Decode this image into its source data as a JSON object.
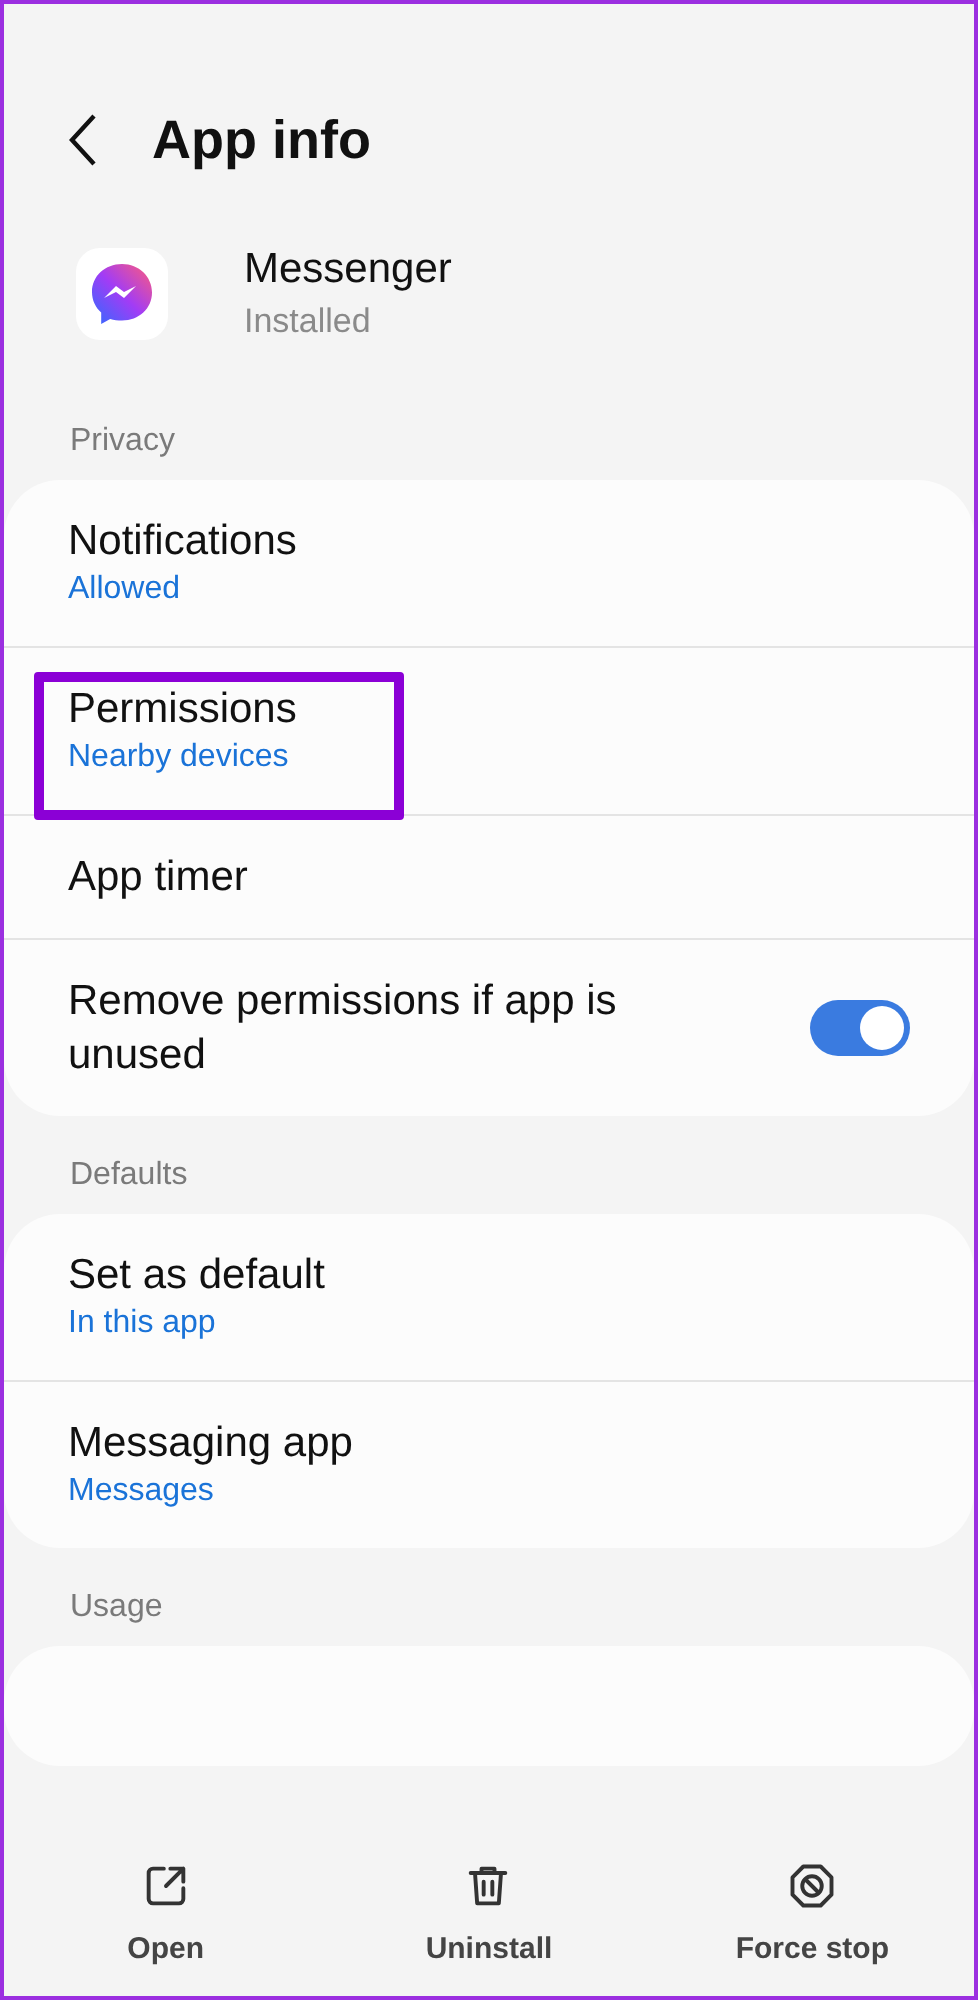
{
  "header": {
    "title": "App info"
  },
  "app": {
    "name": "Messenger",
    "status": "Installed"
  },
  "sections": [
    {
      "label": "Privacy",
      "items": [
        {
          "kind": "link",
          "title": "Notifications",
          "subtitle": "Allowed",
          "highlighted": false
        },
        {
          "kind": "link",
          "title": "Permissions",
          "subtitle": "Nearby devices",
          "highlighted": true
        },
        {
          "kind": "link",
          "title": "App timer",
          "highlighted": false
        },
        {
          "kind": "toggle",
          "title": "Remove permissions if app is unused",
          "on": true,
          "highlighted": false
        }
      ]
    },
    {
      "label": "Defaults",
      "items": [
        {
          "kind": "link",
          "title": "Set as default",
          "subtitle": "In this app",
          "highlighted": false
        },
        {
          "kind": "link",
          "title": "Messaging app",
          "subtitle": "Messages",
          "highlighted": false
        }
      ]
    },
    {
      "label": "Usage"
    }
  ],
  "actions": [
    {
      "kind": "open",
      "label": "Open"
    },
    {
      "kind": "uninstall",
      "label": "Uninstall"
    },
    {
      "kind": "stop",
      "label": "Force stop"
    }
  ]
}
